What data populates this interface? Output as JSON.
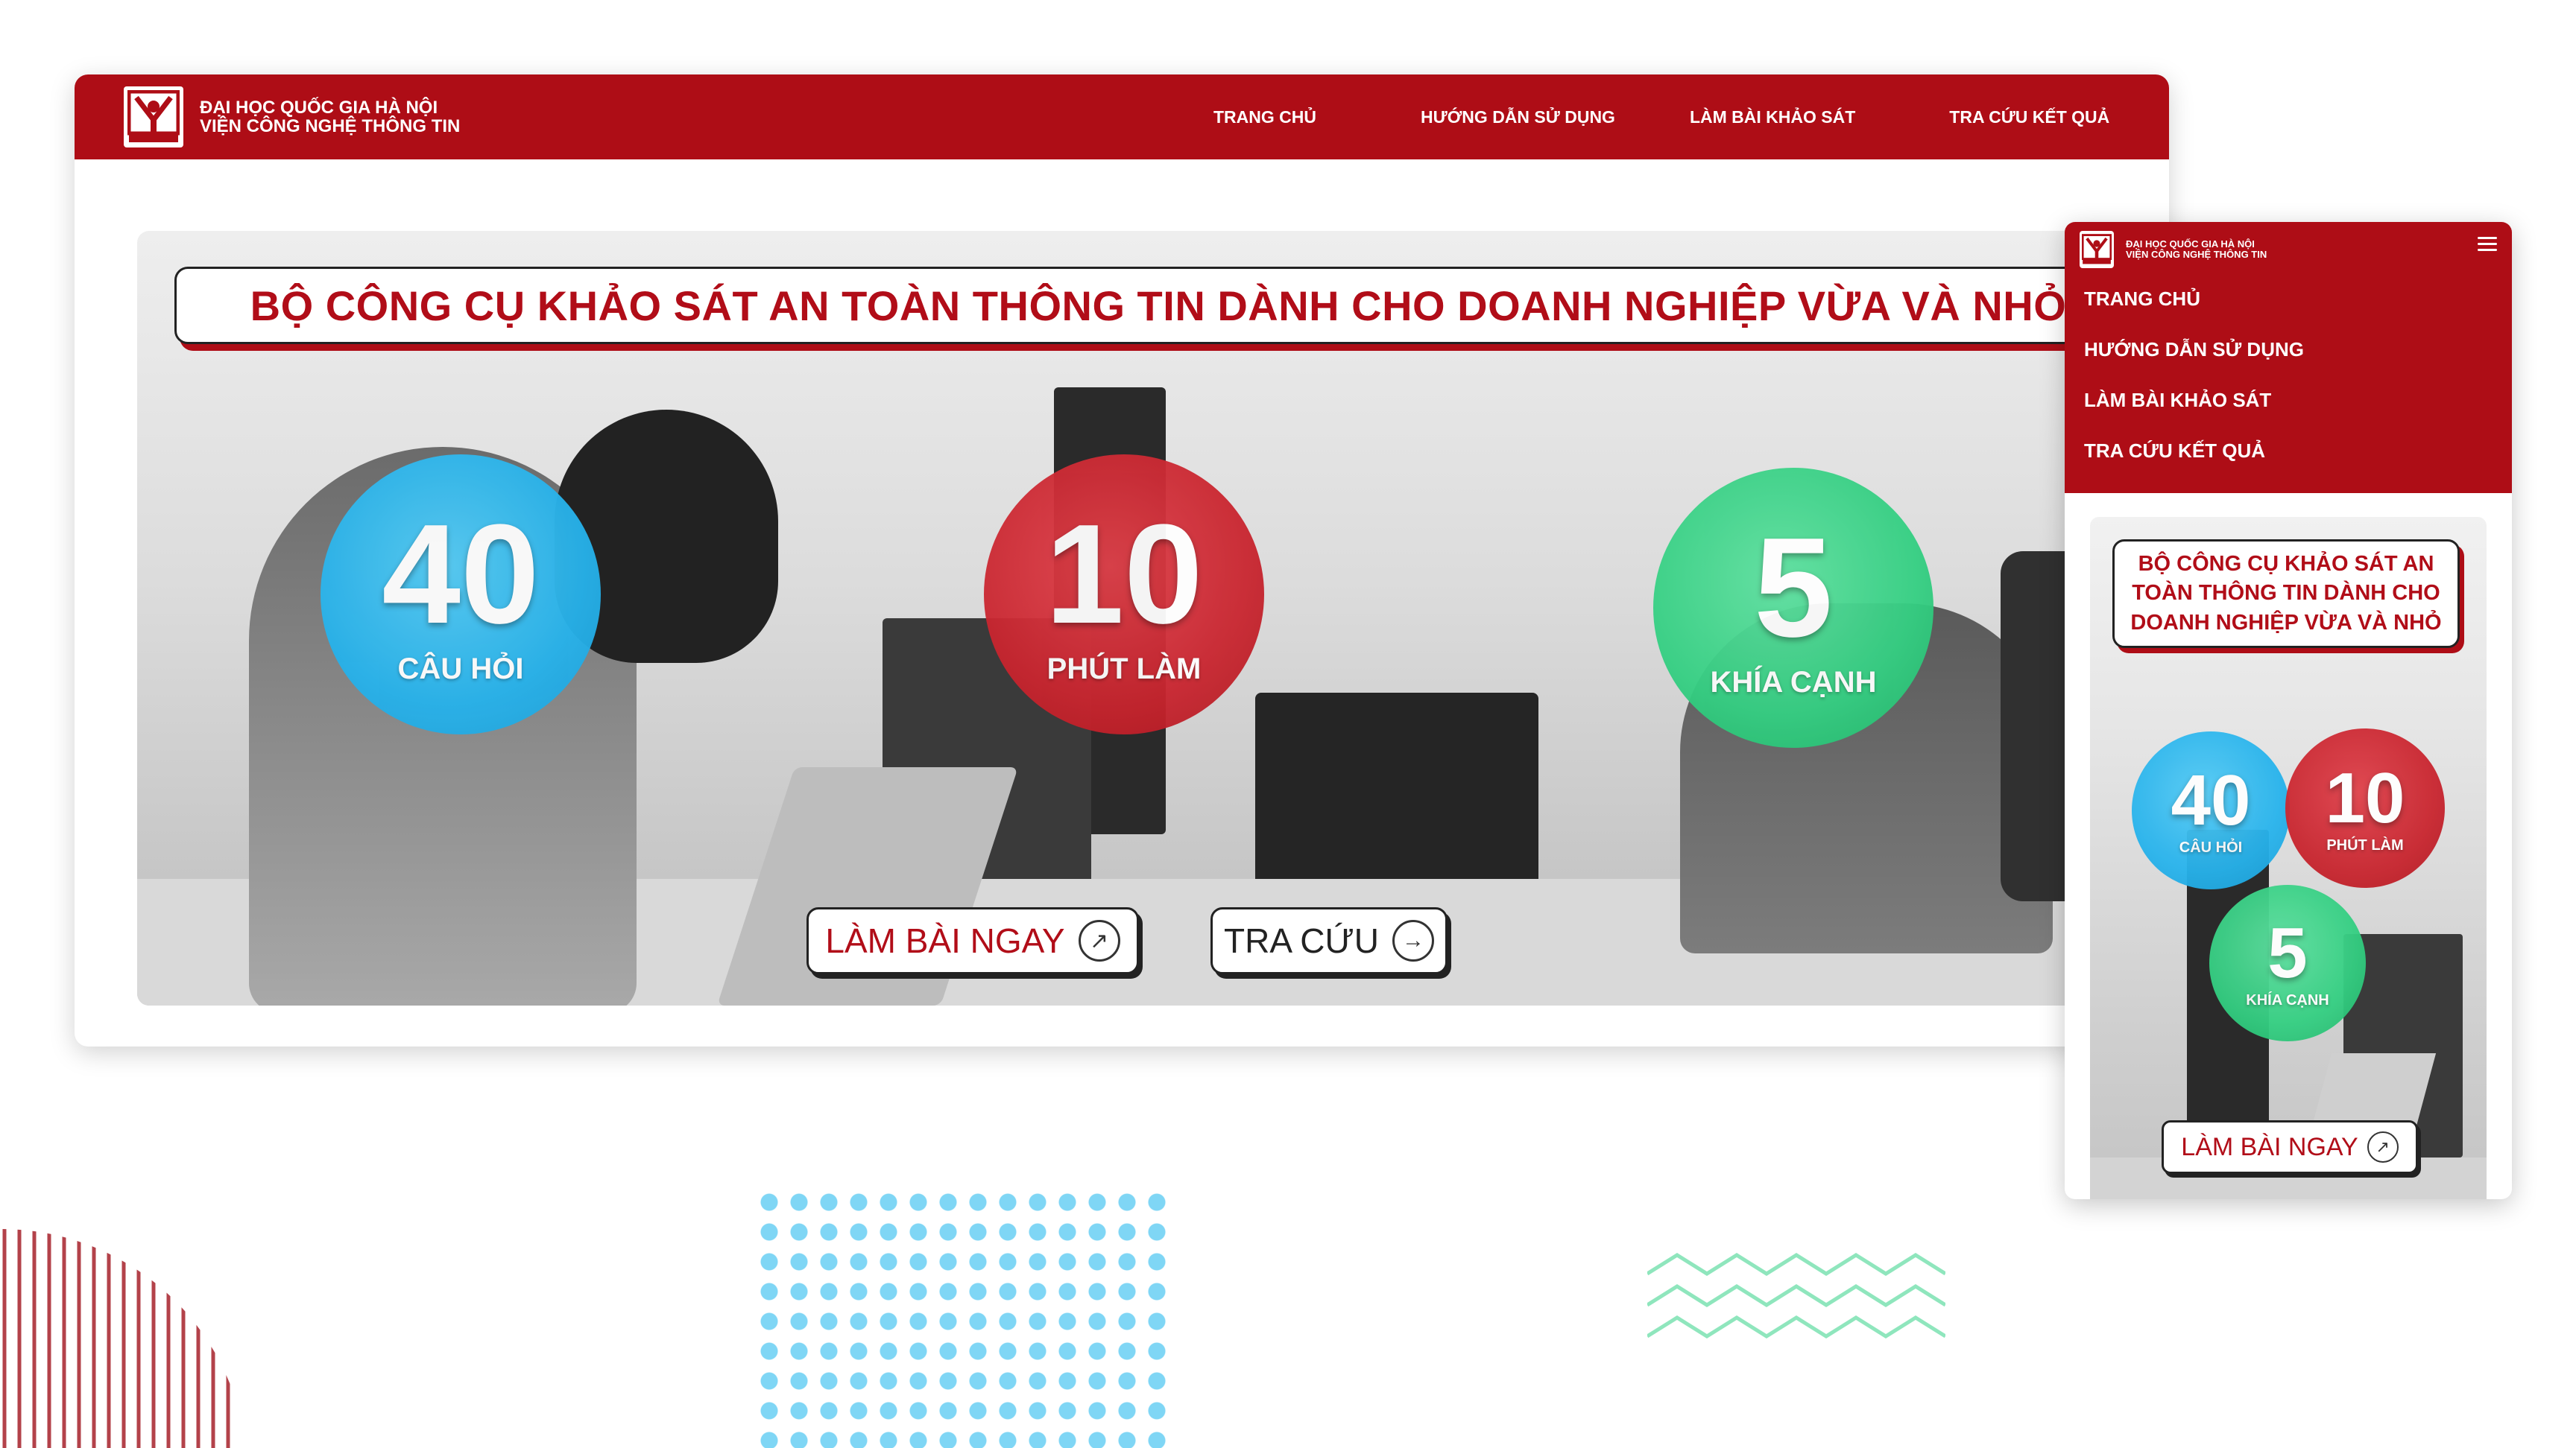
{
  "brand": {
    "line1": "ĐẠI HỌC QUỐC GIA HÀ NỘI",
    "line2": "VIỆN CÔNG NGHỆ THÔNG TIN",
    "logo_tag": "ITI"
  },
  "nav": {
    "items": [
      "TRANG CHỦ",
      "HƯỚNG DẪN SỬ DỤNG",
      "LÀM BÀI KHẢO SÁT",
      "TRA CỨU KẾT QUẢ"
    ]
  },
  "hero": {
    "title": "BỘ CÔNG CỤ KHẢO SÁT AN TOÀN THÔNG TIN DÀNH CHO DOANH NGHIỆP VỪA VÀ NHỎ",
    "stats": [
      {
        "number": "40",
        "label": "CÂU HỎI",
        "color": "#27b3ec"
      },
      {
        "number": "10",
        "label": "PHÚT LÀM",
        "color": "#c9252f"
      },
      {
        "number": "5",
        "label": "KHÍA CẠNH",
        "color": "#34cf82"
      }
    ],
    "cta_primary": {
      "label": "LÀM BÀI NGAY",
      "icon": "arrow-up-right-icon"
    },
    "cta_secondary": {
      "label": "TRA CỨU",
      "icon": "arrow-right-icon"
    }
  },
  "mobile": {
    "menu_icon": "hamburger-icon"
  },
  "colors": {
    "brand_red": "#ae0d16",
    "title_red": "#b10d18",
    "blue": "#27b3ec",
    "red": "#c9252f",
    "green": "#34cf82",
    "dots": "#7fd6f5",
    "zigzag": "#8fe6bd",
    "stripes": "#b3424a"
  }
}
